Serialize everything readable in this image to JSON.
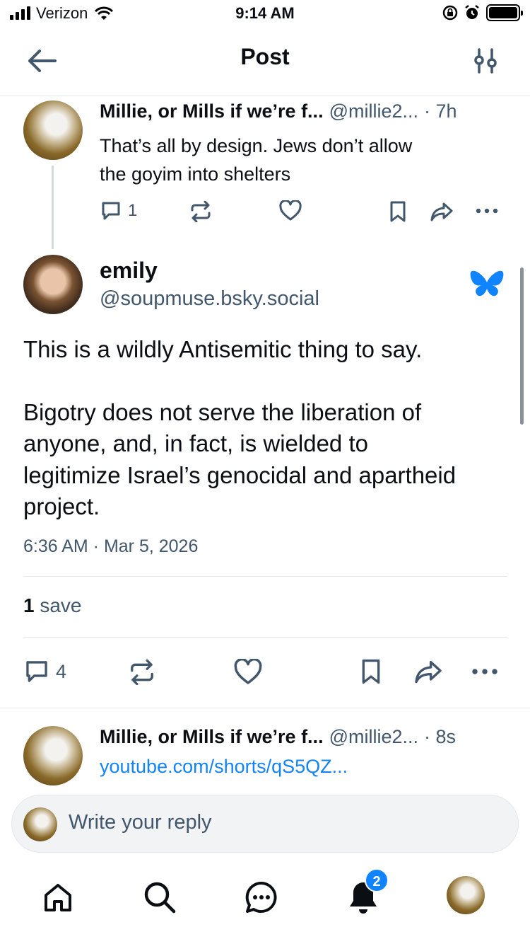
{
  "status_bar": {
    "carrier": "Verizon",
    "time": "9:14 AM"
  },
  "header": {
    "title": "Post",
    "icons": {
      "back": "arrow-left-icon",
      "filter": "sliders-icon"
    }
  },
  "parent_post": {
    "author_name": "Millie, or Mills if we’re f...",
    "author_handle": "@millie2...",
    "age": "· 7h",
    "text_line1": "That’s all by design. Jews don’t allow",
    "text_line2": "the goyim into shelters",
    "reply_count": "1"
  },
  "focused_post": {
    "author_name": "emily",
    "author_handle": "@soupmuse.bsky.social",
    "paragraph1": "This is a wildly Antisemitic thing to say.",
    "paragraph2_line1": "Bigotry does not serve the liberation of",
    "paragraph2_line2": "anyone, and, in fact, is wielded to",
    "paragraph2_line3": "legitimize Israel’s genocidal and apartheid",
    "paragraph2_line4": "project.",
    "timestamp": "6:36 AM · Mar 5, 2026",
    "save_count": "1",
    "save_label": "save",
    "reply_count": "4"
  },
  "reply_post": {
    "author_name": "Millie, or Mills if we’re f...",
    "author_handle": "@millie2...",
    "age": "· 8s",
    "link": "youtube.com/shorts/qS5QZ..."
  },
  "composer": {
    "placeholder": "Write your reply"
  },
  "bottom_nav": {
    "notification_badge": "2",
    "items": [
      "home-icon",
      "search-icon",
      "chat-icon",
      "bell-icon",
      "profile-avatar"
    ]
  },
  "colors": {
    "accent": "#1083fe",
    "secondary_text": "#42576c",
    "divider": "#e4e7eb"
  }
}
